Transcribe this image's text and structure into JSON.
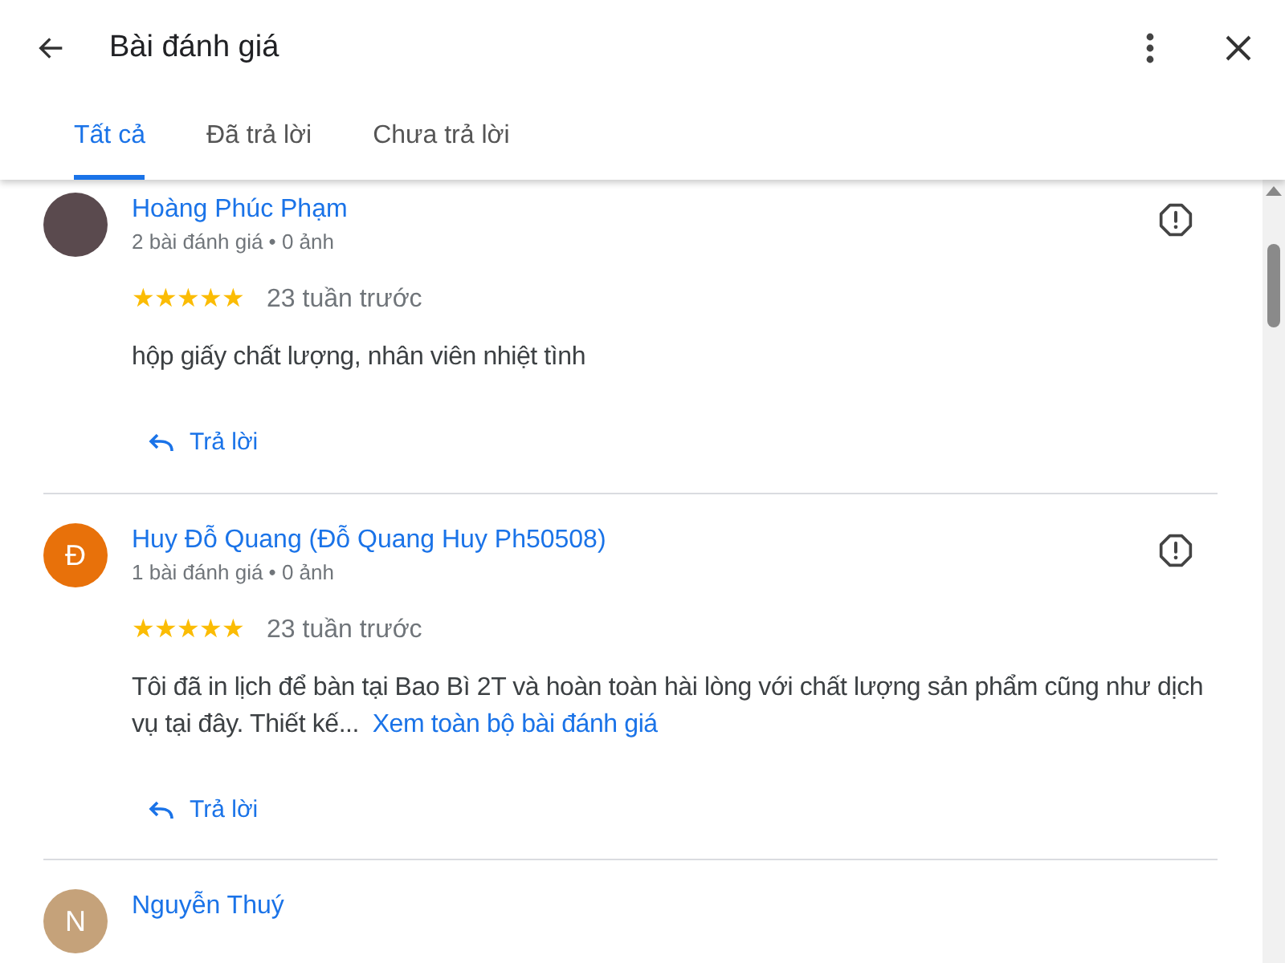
{
  "header": {
    "title": "Bài đánh giá"
  },
  "tabs": [
    {
      "label": "Tất cả",
      "selected": true
    },
    {
      "label": "Đã trả lời",
      "selected": false
    },
    {
      "label": "Chưa trả lời",
      "selected": false
    }
  ],
  "reviews": [
    {
      "name": "Hoàng Phúc Phạm",
      "avatar": {
        "kind": "photo"
      },
      "meta": "2 bài đánh giá • 0 ảnh",
      "stars": 5,
      "time": "23 tuần trước",
      "text": "hộp giấy chất lượng, nhân viên nhiệt tình",
      "reply": "Trả lời"
    },
    {
      "name": "Huy Đỗ Quang (Đỗ Quang Huy Ph50508)",
      "avatar": {
        "kind": "letter",
        "letter": "Đ",
        "color": "#e8710a"
      },
      "meta": "1 bài đánh giá • 0 ảnh",
      "stars": 5,
      "time": "23 tuần trước",
      "text": "Tôi đã in lịch để bàn tại Bao Bì 2T và hoàn toàn hài lòng với chất lượng sản phẩm cũng như dịch vụ tại đây. Thiết kế...",
      "more": "Xem toàn bộ bài đánh giá",
      "reply": "Trả lời"
    },
    {
      "name": "Nguyễn Thuý",
      "avatar": {
        "kind": "letter",
        "letter": "N",
        "color": "#c5a27a"
      }
    }
  ]
}
